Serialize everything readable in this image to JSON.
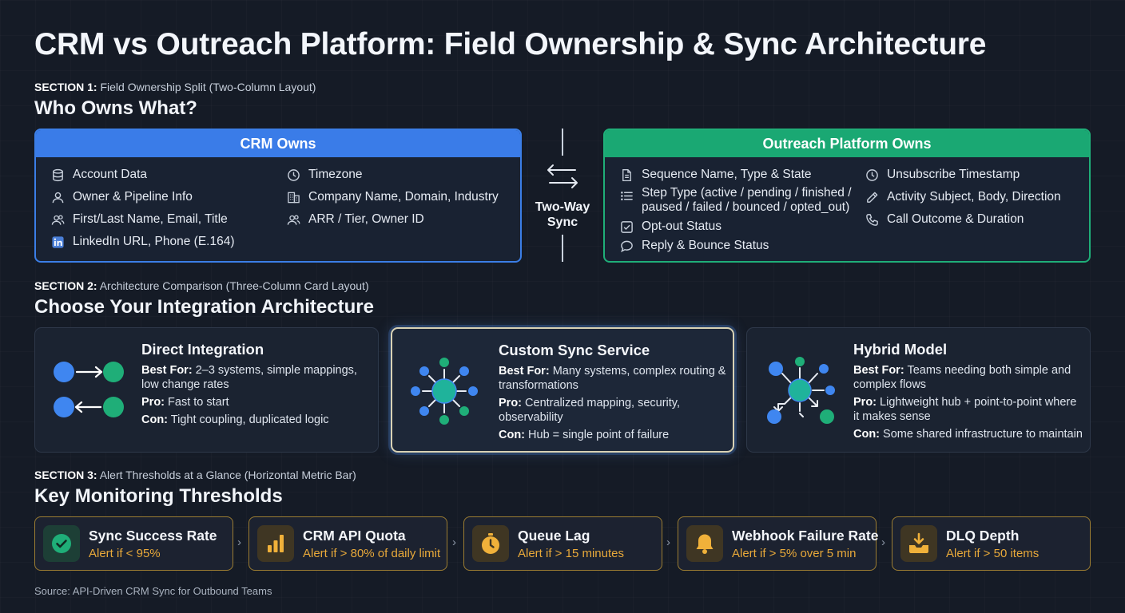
{
  "title": "CRM vs Outreach Platform: Field Ownership & Sync Architecture",
  "section1": {
    "label_bold": "SECTION 1:",
    "label_rest": "Field Ownership Split (Two-Column Layout)",
    "heading": "Who Owns What?",
    "crm": {
      "header": "CRM Owns",
      "items": [
        {
          "icon": "database-icon",
          "text": "Account Data"
        },
        {
          "icon": "user-icon",
          "text": "Owner & Pipeline Info"
        },
        {
          "icon": "users-icon",
          "text": "First/Last Name, Email, Title"
        },
        {
          "icon": "linkedin-icon",
          "text": "LinkedIn URL, Phone (E.164)"
        },
        {
          "icon": "clock-icon",
          "text": "Timezone"
        },
        {
          "icon": "building-icon",
          "text": "Company Name, Domain, Industry"
        },
        {
          "icon": "users-icon",
          "text": "ARR / Tier, Owner ID"
        }
      ]
    },
    "sync": {
      "line1": "Two-Way",
      "line2": "Sync",
      "icon": "two-way-arrows-icon"
    },
    "outreach": {
      "header": "Outreach Platform Owns",
      "items": [
        {
          "icon": "document-icon",
          "text": "Sequence Name, Type & State"
        },
        {
          "icon": "list-icon",
          "text": "Step Type (active / pending / finished /",
          "text2": "paused / failed / bounced / opted_out)"
        },
        {
          "icon": "checkbox-icon",
          "text": "Opt-out Status"
        },
        {
          "icon": "chat-bubble-icon",
          "text": "Reply & Bounce Status"
        },
        {
          "icon": "clock-icon",
          "text": "Unsubscribe Timestamp"
        },
        {
          "icon": "pencil-icon",
          "text": "Activity Subject, Body, Direction"
        },
        {
          "icon": "phone-icon",
          "text": "Call Outcome & Duration"
        }
      ]
    }
  },
  "section2": {
    "label_bold": "SECTION 2:",
    "label_rest": "Architecture Comparison (Three-Column Card Layout)",
    "heading": "Choose Your Integration Architecture",
    "cards": [
      {
        "title": "Direct Integration",
        "best_label": "Best For:",
        "best": "2–3 systems, simple mappings, low change rates",
        "pro_label": "Pro:",
        "pro": "Fast to start",
        "con_label": "Con:",
        "con": "Tight coupling, duplicated logic"
      },
      {
        "title": "Custom Sync Service",
        "best_label": "Best For:",
        "best": "Many systems, complex routing & transformations",
        "pro_label": "Pro:",
        "pro": "Centralized mapping, security, observability",
        "con_label": "Con:",
        "con": "Hub = single point of failure"
      },
      {
        "title": "Hybrid Model",
        "best_label": "Best For:",
        "best": "Teams needing both simple and complex flows",
        "pro_label": "Pro:",
        "pro": "Lightweight hub + point-to-point where it makes sense",
        "con_label": "Con:",
        "con": "Some shared infrastructure to maintain"
      }
    ]
  },
  "section3": {
    "label_bold": "SECTION 3:",
    "label_rest": "Alert Thresholds at a Glance (Horizontal Metric Bar)",
    "heading": "Key Monitoring Thresholds",
    "metrics": [
      {
        "icon": "check-circle-icon",
        "name": "Sync Success Rate",
        "alert": "Alert if < 95%"
      },
      {
        "icon": "bar-chart-icon",
        "name": "CRM API Quota",
        "alert": "Alert if > 80% of daily limit"
      },
      {
        "icon": "stopwatch-icon",
        "name": "Queue Lag",
        "alert": "Alert if > 15 minutes"
      },
      {
        "icon": "bell-icon",
        "name": "Webhook Failure Rate",
        "alert": "Alert if > 5% over 5 min"
      },
      {
        "icon": "inbox-download-icon",
        "name": "DLQ Depth",
        "alert": "Alert if > 50 items"
      }
    ],
    "separator": "›"
  },
  "source": "Source: API-Driven CRM Sync for Outbound Teams",
  "colors": {
    "crm_blue": "#3a7ce8",
    "outreach_green": "#1aa873",
    "alert_amber": "#e8a93a",
    "node_blue": "#3f86f0",
    "node_green": "#1fae78"
  }
}
